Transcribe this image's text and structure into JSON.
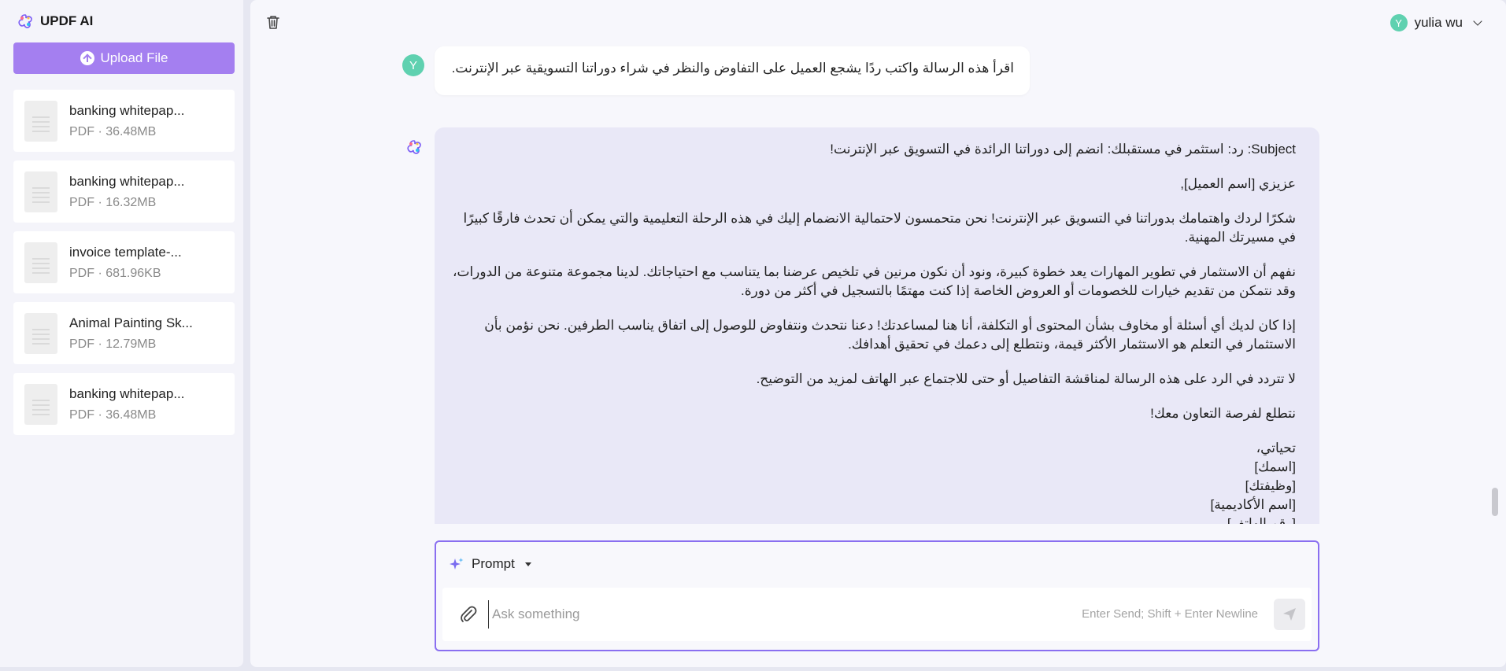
{
  "app": {
    "brand_name": "UPDF AI",
    "brand_icon": "updf-logo-icon",
    "accent_color": "#a47ff0"
  },
  "sidebar": {
    "upload_label": "Upload File",
    "files": [
      {
        "name": "banking whitepap...",
        "meta": "PDF · 36.48MB"
      },
      {
        "name": "banking whitepap...",
        "meta": "PDF · 16.32MB"
      },
      {
        "name": "invoice template-...",
        "meta": "PDF · 681.96KB"
      },
      {
        "name": "Animal Painting Sk...",
        "meta": "PDF · 12.79MB"
      },
      {
        "name": "banking whitepap...",
        "meta": "PDF · 36.48MB"
      }
    ]
  },
  "header": {
    "user_initial": "Y",
    "user_name": "yulia wu"
  },
  "chat": {
    "user_initial": "Y",
    "user_message": "اقرأ هذه الرسالة واكتب ردًا يشجع العميل على التفاوض والنظر في شراء دوراتنا التسويقية عبر الإنترنت.",
    "ai_paragraphs": [
      "Subject: رد: استثمر في مستقبلك: انضم إلى دوراتنا الرائدة في التسويق عبر الإنترنت!",
      "عزيزي [اسم العميل],",
      "شكرًا لردك واهتمامك بدوراتنا في التسويق عبر الإنترنت! نحن متحمسون لاحتمالية الانضمام إليك في هذه الرحلة التعليمية والتي يمكن أن تحدث فارقًا كبيرًا في مسيرتك المهنية.",
      "نفهم أن الاستثمار في تطوير المهارات يعد خطوة كبيرة، ونود أن نكون مرنين في تلخيص عرضنا بما يتناسب مع احتياجاتك. لدينا مجموعة متنوعة من الدورات، وقد نتمكن من تقديم خيارات للخصومات أو العروض الخاصة إذا كنت مهتمًا بالتسجيل في أكثر من دورة.",
      "إذا كان لديك أي أسئلة أو مخاوف بشأن المحتوى أو التكلفة، أنا هنا لمساعدتك! دعنا نتحدث ونتفاوض للوصول إلى اتفاق يناسب الطرفين. نحن نؤمن بأن الاستثمار في التعلم هو الاستثمار الأكثر قيمة، ونتطلع إلى دعمك في تحقيق أهدافك.",
      "لا تتردد في الرد على هذه الرسالة لمناقشة التفاصيل أو حتى للاجتماع عبر الهاتف لمزيد من التوضيح.",
      "نتطلع لفرصة التعاون معك!"
    ],
    "ai_signature": [
      "تحياتي،",
      "[اسمك]",
      "[وظيفتك]",
      "[اسم الأكاديمية]",
      "[رقم الهاتف]"
    ]
  },
  "composer": {
    "prompt_label": "Prompt",
    "placeholder": "Ask something",
    "value": "",
    "hint": "Enter Send; Shift + Enter Newline"
  }
}
